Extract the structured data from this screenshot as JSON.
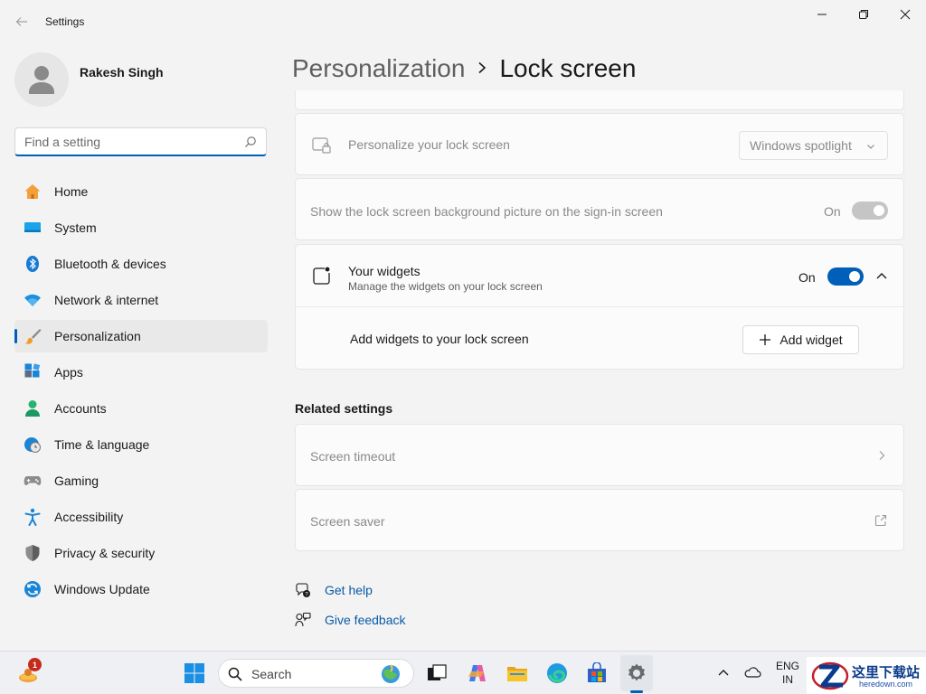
{
  "window": {
    "title": "Settings"
  },
  "user": {
    "name": "Rakesh Singh"
  },
  "search": {
    "placeholder": "Find a setting"
  },
  "nav": [
    {
      "label": "Home",
      "icon": "home-icon"
    },
    {
      "label": "System",
      "icon": "system-icon"
    },
    {
      "label": "Bluetooth & devices",
      "icon": "bluetooth-icon"
    },
    {
      "label": "Network & internet",
      "icon": "wifi-icon"
    },
    {
      "label": "Personalization",
      "icon": "brush-icon",
      "active": true
    },
    {
      "label": "Apps",
      "icon": "apps-icon"
    },
    {
      "label": "Accounts",
      "icon": "accounts-icon"
    },
    {
      "label": "Time & language",
      "icon": "clock-globe-icon"
    },
    {
      "label": "Gaming",
      "icon": "gamepad-icon"
    },
    {
      "label": "Accessibility",
      "icon": "accessibility-icon"
    },
    {
      "label": "Privacy & security",
      "icon": "shield-icon"
    },
    {
      "label": "Windows Update",
      "icon": "update-icon"
    }
  ],
  "breadcrumb": {
    "parent": "Personalization",
    "current": "Lock screen"
  },
  "settings": {
    "personalize": {
      "title": "Personalize your lock screen",
      "value": "Windows spotlight"
    },
    "signin_bg": {
      "title": "Show the lock screen background picture on the sign-in screen",
      "state": "On"
    },
    "widgets": {
      "title": "Your widgets",
      "description": "Manage the widgets on your lock screen",
      "state": "On",
      "add_text": "Add widgets to your lock screen",
      "add_button": "Add widget"
    }
  },
  "related": {
    "title": "Related settings",
    "items": [
      {
        "label": "Screen timeout"
      },
      {
        "label": "Screen saver"
      }
    ]
  },
  "help": {
    "get_help": "Get help",
    "feedback": "Give feedback"
  },
  "taskbar": {
    "search_label": "Search",
    "badge_count": "1",
    "lang_line1": "ENG",
    "lang_line2": "IN"
  },
  "watermark": {
    "text": "这里下载站",
    "sub": "heredown.com"
  },
  "colors": {
    "accent": "#005fb8",
    "background": "#f3f3f3",
    "card": "#fbfbfb"
  }
}
